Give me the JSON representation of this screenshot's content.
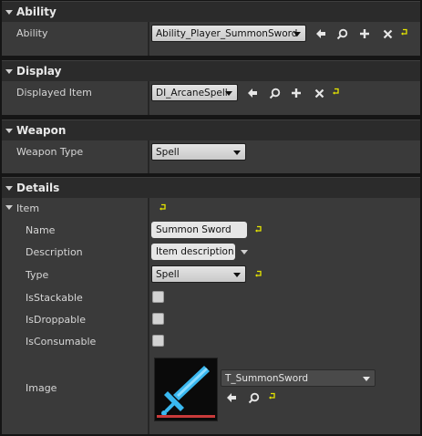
{
  "sections": {
    "ability": {
      "title": "Ability"
    },
    "display": {
      "title": "Display"
    },
    "weapon": {
      "title": "Weapon"
    },
    "details": {
      "title": "Details"
    }
  },
  "ability": {
    "label": "Ability",
    "value": "Ability_Player_SummonSword"
  },
  "display": {
    "label": "Displayed Item",
    "value": "DI_ArcaneSpell"
  },
  "weapon": {
    "label": "Weapon Type",
    "value": "Spell"
  },
  "item": {
    "label": "Item",
    "name_label": "Name",
    "name_value": "Summon Sword",
    "description_label": "Description",
    "description_value": "Item description",
    "type_label": "Type",
    "type_value": "Spell",
    "stackable_label": "IsStackable",
    "droppable_label": "IsDroppable",
    "consumable_label": "IsConsumable",
    "image_label": "Image",
    "image_value": "T_SummonSword",
    "is_stackable": false,
    "is_droppable": false,
    "is_consumable": false
  },
  "colors": {
    "reset_arrow": "#e6e600",
    "sword_blue": "#39b8f0",
    "sword_dark": "#0a0a0a",
    "thumb_underline": "#c83a3a"
  },
  "icons": [
    "expand-arrow-icon",
    "use-selected-arrow-icon",
    "browse-magnifier-icon",
    "add-plus-icon",
    "clear-x-icon",
    "reset-to-default-icon",
    "dropdown-caret-icon",
    "sword-thumbnail-icon"
  ]
}
